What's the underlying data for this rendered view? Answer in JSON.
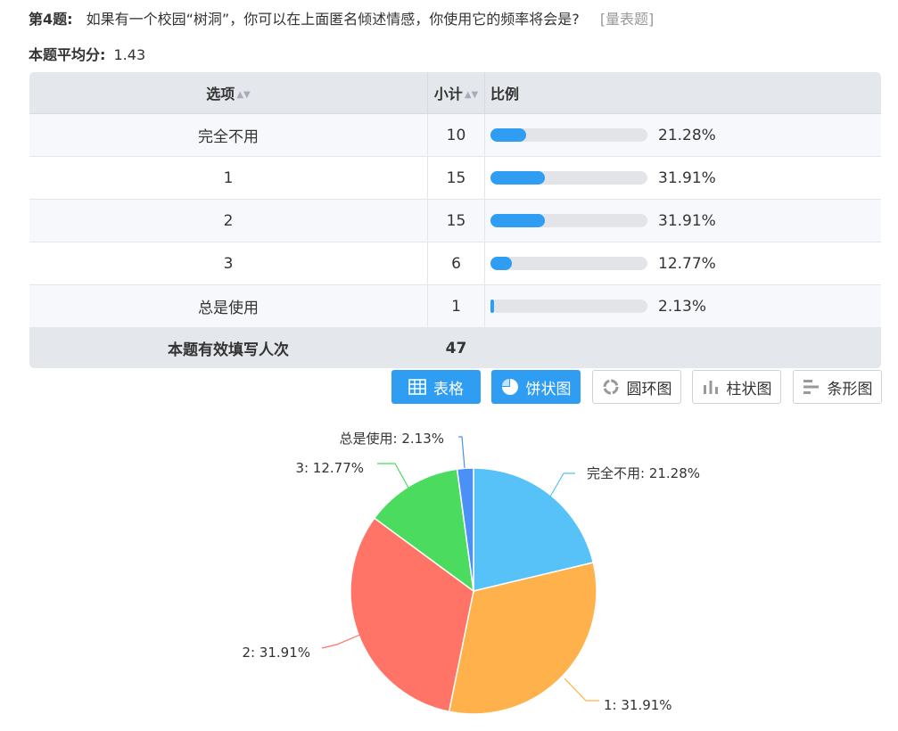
{
  "question": {
    "number": "第4题:",
    "text": "如果有一个校园“树洞”，你可以在上面匿名倾述情感，你使用它的频率将会是?",
    "type": "[量表题]"
  },
  "average": {
    "label": "本题平均分:",
    "value": "1.43"
  },
  "table": {
    "headers": {
      "option": "选项",
      "count": "小计",
      "ratio": "比例"
    },
    "rows": [
      {
        "option": "完全不用",
        "count": "10",
        "percent": "21.28%",
        "fraction": 0.2128
      },
      {
        "option": "1",
        "count": "15",
        "percent": "31.91%",
        "fraction": 0.3191
      },
      {
        "option": "2",
        "count": "15",
        "percent": "31.91%",
        "fraction": 0.3191
      },
      {
        "option": "3",
        "count": "6",
        "percent": "12.77%",
        "fraction": 0.1277
      },
      {
        "option": "总是使用",
        "count": "1",
        "percent": "2.13%",
        "fraction": 0.0213
      }
    ],
    "total": {
      "label": "本题有效填写人次",
      "count": "47"
    }
  },
  "view_buttons": [
    {
      "label": "表格",
      "icon": "table-icon",
      "active": true
    },
    {
      "label": "饼状图",
      "icon": "pie-icon",
      "active": true
    },
    {
      "label": "圆环图",
      "icon": "donut-icon",
      "active": false
    },
    {
      "label": "柱状图",
      "icon": "bar-chart-icon",
      "active": false
    },
    {
      "label": "条形图",
      "icon": "hbar-chart-icon",
      "active": false
    }
  ],
  "chart_data": {
    "type": "pie",
    "categories": [
      "完全不用",
      "1",
      "2",
      "3",
      "总是使用"
    ],
    "values": [
      21.28,
      31.91,
      31.91,
      12.77,
      2.13
    ],
    "labels": [
      "完全不用: 21.28%",
      "1: 31.91%",
      "2: 31.91%",
      "3: 12.77%",
      "总是使用: 2.13%"
    ],
    "colors": [
      "#56c2f8",
      "#ffb24b",
      "#ff7466",
      "#4bdb5f",
      "#4a90f7"
    ],
    "legend": false
  }
}
